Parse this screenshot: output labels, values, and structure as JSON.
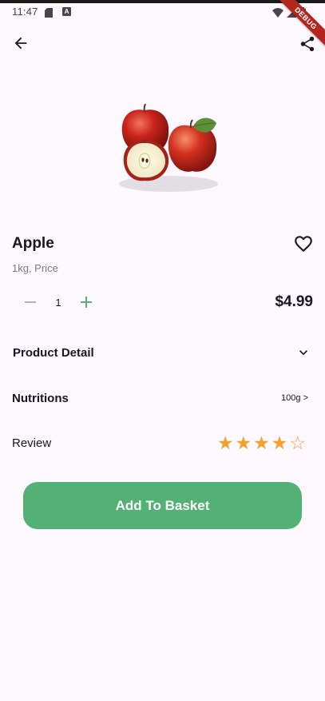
{
  "status_bar": {
    "time": "11:47",
    "a_icon_letter": "A",
    "debug_banner": "DEBUG"
  },
  "header": {
    "back_icon": "arrow-left-icon",
    "share_icon": "share-icon"
  },
  "product": {
    "image": "apple-product-image",
    "name": "Apple",
    "unit": "1kg, Price",
    "favorite_icon": "heart-outline-icon",
    "quantity": "1",
    "price": "$4.99"
  },
  "sections": {
    "detail_label": "Product Detail",
    "nutritions_label": "Nutritions",
    "nutritions_value": "100g >",
    "review_label": "Review",
    "rating": 4,
    "rating_max": 5
  },
  "actions": {
    "add_to_basket": "Add To Basket"
  },
  "colors": {
    "background": "#fdf7fe",
    "accent_green": "#53b175",
    "star_orange": "#f3a02c",
    "text_dark": "#181725",
    "text_muted": "#7c7c7c"
  }
}
